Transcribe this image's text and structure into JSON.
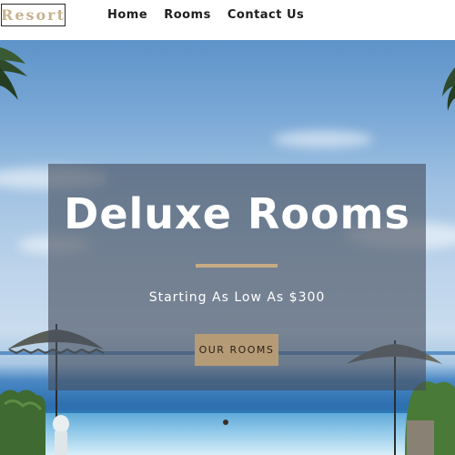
{
  "navbar": {
    "logo_text": "Resort",
    "links": [
      {
        "label": "Home"
      },
      {
        "label": "Rooms"
      },
      {
        "label": "Contact Us"
      }
    ]
  },
  "hero": {
    "title": "Deluxe Rooms",
    "subtitle": "Starting As Low As $300",
    "button_label": "OUR ROOMS"
  },
  "colors": {
    "accent": "#c7ab84",
    "button_bg": "#b69b77",
    "overlay": "rgba(70,78,92,0.62)",
    "nav_text": "#1e1e1e"
  }
}
